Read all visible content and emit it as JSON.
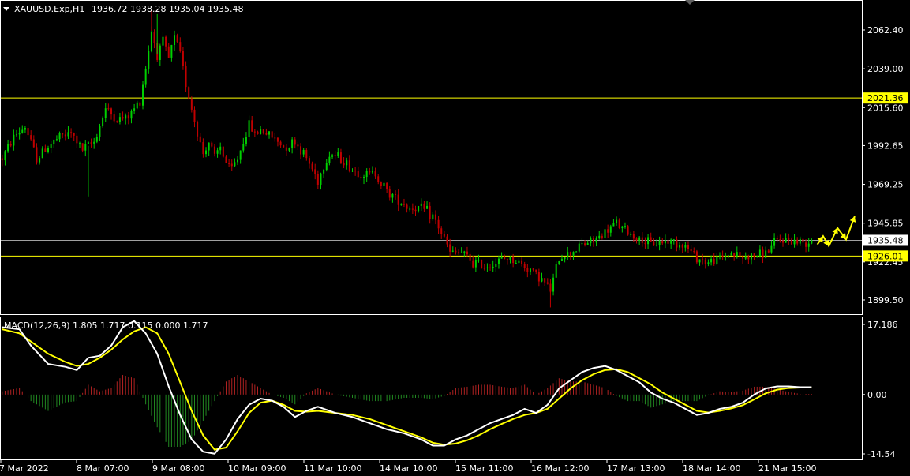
{
  "header": {
    "symbol": "XAUUSD.Exp,H1",
    "ohlc": "1936.72 1938.28 1935.04 1935.48"
  },
  "macd_header": {
    "label": "MACD(12,26,9) 1.805 1.717 0.115 0.000 1.717"
  },
  "colors": {
    "background": "#000000",
    "frame": "#ffffff",
    "bull": "#00d000",
    "bear": "#c00000",
    "level_line": "#ffff00",
    "price_line": "#a0a0a0",
    "macd_line": "#ffffff",
    "signal_line": "#ffff00",
    "hist_pos": "#b22222",
    "hist_neg": "#228b22",
    "arrow": "#ffff00"
  },
  "chart_data": [
    {
      "type": "candlestick",
      "title": "XAUUSD.Exp,H1",
      "ylim": [
        1893.0,
        2075.0
      ],
      "y_ticks": [
        "2062.40",
        "2039.00",
        "2015.60",
        "1992.65",
        "1969.25",
        "1945.85",
        "1922.45",
        "1899.50"
      ],
      "x_labels": [
        "7 Mar 2022",
        "8 Mar 07:00",
        "9 Mar 08:00",
        "10 Mar 09:00",
        "11 Mar 10:00",
        "14 Mar 10:00",
        "15 Mar 11:00",
        "16 Mar 12:00",
        "17 Mar 13:00",
        "18 Mar 14:00",
        "21 Mar 15:00"
      ],
      "horizontal_levels": [
        {
          "label": "2021.36",
          "value": 2021.36
        },
        {
          "label": "1926.01",
          "value": 1926.01
        }
      ],
      "current_price": {
        "label": "1935.48",
        "value": 1935.48
      },
      "close_path": [
        [
          0,
          1985
        ],
        [
          4,
          1998
        ],
        [
          8,
          2004
        ],
        [
          12,
          1985
        ],
        [
          16,
          1992
        ],
        [
          20,
          1998
        ],
        [
          24,
          2000
        ],
        [
          28,
          1990
        ],
        [
          32,
          1995
        ],
        [
          36,
          2015
        ],
        [
          40,
          2008
        ],
        [
          44,
          2010
        ],
        [
          48,
          2020
        ],
        [
          50,
          2040
        ],
        [
          52,
          2062
        ],
        [
          54,
          2048
        ],
        [
          56,
          2055
        ],
        [
          58,
          2045
        ],
        [
          60,
          2058
        ],
        [
          62,
          2048
        ],
        [
          64,
          2030
        ],
        [
          66,
          2015
        ],
        [
          68,
          2000
        ],
        [
          70,
          1988
        ],
        [
          72,
          1995
        ],
        [
          74,
          1985
        ],
        [
          76,
          1992
        ],
        [
          78,
          1982
        ],
        [
          80,
          1978
        ],
        [
          82,
          1985
        ],
        [
          84,
          1995
        ],
        [
          86,
          2005
        ],
        [
          88,
          2000
        ],
        [
          90,
          2002
        ],
        [
          94,
          1998
        ],
        [
          98,
          1992
        ],
        [
          102,
          1995
        ],
        [
          106,
          1985
        ],
        [
          110,
          1972
        ],
        [
          114,
          1988
        ],
        [
          118,
          1985
        ],
        [
          122,
          1978
        ],
        [
          126,
          1975
        ],
        [
          130,
          1976
        ],
        [
          134,
          1965
        ],
        [
          138,
          1960
        ],
        [
          142,
          1955
        ],
        [
          146,
          1955
        ],
        [
          150,
          1950
        ],
        [
          153,
          1940
        ],
        [
          156,
          1928
        ],
        [
          160,
          1928
        ],
        [
          164,
          1922
        ],
        [
          168,
          1920
        ],
        [
          172,
          1922
        ],
        [
          176,
          1925
        ],
        [
          180,
          1922
        ],
        [
          184,
          1918
        ],
        [
          188,
          1912
        ],
        [
          191,
          1905
        ],
        [
          194,
          1925
        ],
        [
          198,
          1928
        ],
        [
          202,
          1933
        ],
        [
          206,
          1935
        ],
        [
          210,
          1940
        ],
        [
          214,
          1946
        ],
        [
          218,
          1940
        ],
        [
          222,
          1936
        ],
        [
          226,
          1933
        ],
        [
          230,
          1935
        ],
        [
          234,
          1935
        ],
        [
          238,
          1932
        ],
        [
          242,
          1925
        ],
        [
          246,
          1922
        ],
        [
          250,
          1925
        ],
        [
          254,
          1928
        ],
        [
          258,
          1925
        ],
        [
          262,
          1926
        ],
        [
          266,
          1928
        ],
        [
          270,
          1935
        ],
        [
          274,
          1936
        ],
        [
          278,
          1934
        ],
        [
          282,
          1935.48
        ]
      ],
      "forecast_arrow": [
        [
          284,
          1933
        ],
        [
          286,
          1938
        ],
        [
          288,
          1932
        ],
        [
          291,
          1943
        ],
        [
          294,
          1936
        ],
        [
          297,
          1950
        ]
      ]
    },
    {
      "type": "macd",
      "title": "MACD(12,26,9)",
      "params": [
        12,
        26,
        9
      ],
      "values": {
        "macd": 1.805,
        "signal": 1.717,
        "osma": 0.115,
        "level": 0.0,
        "value": 1.717
      },
      "ylim": [
        -15.5,
        18.0
      ],
      "y_ticks": [
        "17.186",
        "0.00",
        "-14.54"
      ],
      "series": [
        {
          "name": "MACD",
          "points": [
            [
              0,
              16.5
            ],
            [
              6,
              16.0
            ],
            [
              10,
              12.0
            ],
            [
              16,
              7.5
            ],
            [
              22,
              6.8
            ],
            [
              26,
              6.0
            ],
            [
              30,
              9.0
            ],
            [
              34,
              9.5
            ],
            [
              38,
              12.0
            ],
            [
              42,
              16.5
            ],
            [
              46,
              18.0
            ],
            [
              50,
              15.0
            ],
            [
              54,
              10.0
            ],
            [
              58,
              2.0
            ],
            [
              62,
              -5.0
            ],
            [
              66,
              -11.0
            ],
            [
              70,
              -14.0
            ],
            [
              74,
              -14.5
            ],
            [
              78,
              -11.0
            ],
            [
              82,
              -6.0
            ],
            [
              86,
              -2.5
            ],
            [
              90,
              -1.0
            ],
            [
              94,
              -1.5
            ],
            [
              98,
              -3.0
            ],
            [
              102,
              -5.5
            ],
            [
              106,
              -4.0
            ],
            [
              110,
              -3.0
            ],
            [
              116,
              -4.5
            ],
            [
              122,
              -5.5
            ],
            [
              128,
              -7.0
            ],
            [
              134,
              -8.5
            ],
            [
              140,
              -9.5
            ],
            [
              146,
              -11.0
            ],
            [
              150,
              -12.5
            ],
            [
              154,
              -12.5
            ],
            [
              158,
              -11.0
            ],
            [
              162,
              -10.0
            ],
            [
              166,
              -8.5
            ],
            [
              170,
              -7.0
            ],
            [
              174,
              -6.0
            ],
            [
              178,
              -5.0
            ],
            [
              182,
              -3.5
            ],
            [
              186,
              -4.5
            ],
            [
              190,
              -2.5
            ],
            [
              194,
              1.5
            ],
            [
              198,
              3.5
            ],
            [
              202,
              5.5
            ],
            [
              206,
              6.5
            ],
            [
              210,
              7.0
            ],
            [
              214,
              6.0
            ],
            [
              218,
              4.5
            ],
            [
              222,
              3.0
            ],
            [
              226,
              0.5
            ],
            [
              230,
              -1.0
            ],
            [
              234,
              -2.0
            ],
            [
              238,
              -3.5
            ],
            [
              242,
              -5.0
            ],
            [
              246,
              -4.5
            ],
            [
              250,
              -3.5
            ],
            [
              254,
              -3.0
            ],
            [
              258,
              -2.0
            ],
            [
              262,
              0.0
            ],
            [
              266,
              1.5
            ],
            [
              270,
              2.0
            ],
            [
              274,
              2.0
            ],
            [
              278,
              1.8
            ],
            [
              282,
              1.805
            ]
          ]
        },
        {
          "name": "Signal",
          "points": [
            [
              0,
              16.0
            ],
            [
              6,
              15.0
            ],
            [
              10,
              13.0
            ],
            [
              16,
              10.0
            ],
            [
              22,
              8.0
            ],
            [
              26,
              7.0
            ],
            [
              30,
              7.5
            ],
            [
              34,
              9.0
            ],
            [
              38,
              11.0
            ],
            [
              42,
              13.5
            ],
            [
              46,
              15.5
            ],
            [
              50,
              16.5
            ],
            [
              54,
              15.0
            ],
            [
              58,
              10.0
            ],
            [
              62,
              3.0
            ],
            [
              66,
              -4.0
            ],
            [
              70,
              -10.0
            ],
            [
              74,
              -13.5
            ],
            [
              78,
              -13.0
            ],
            [
              82,
              -9.0
            ],
            [
              86,
              -4.5
            ],
            [
              90,
              -2.0
            ],
            [
              94,
              -1.5
            ],
            [
              98,
              -2.5
            ],
            [
              102,
              -4.0
            ],
            [
              106,
              -4.2
            ],
            [
              110,
              -4.0
            ],
            [
              116,
              -4.5
            ],
            [
              122,
              -5.0
            ],
            [
              128,
              -6.0
            ],
            [
              134,
              -7.5
            ],
            [
              140,
              -9.0
            ],
            [
              146,
              -10.5
            ],
            [
              150,
              -11.8
            ],
            [
              154,
              -12.3
            ],
            [
              158,
              -12.0
            ],
            [
              162,
              -11.2
            ],
            [
              166,
              -10.0
            ],
            [
              170,
              -8.5
            ],
            [
              174,
              -7.2
            ],
            [
              178,
              -6.0
            ],
            [
              182,
              -5.0
            ],
            [
              186,
              -4.5
            ],
            [
              190,
              -3.5
            ],
            [
              194,
              -1.0
            ],
            [
              198,
              1.5
            ],
            [
              202,
              3.5
            ],
            [
              206,
              5.0
            ],
            [
              210,
              6.0
            ],
            [
              214,
              6.2
            ],
            [
              218,
              5.5
            ],
            [
              222,
              4.0
            ],
            [
              226,
              2.5
            ],
            [
              230,
              0.5
            ],
            [
              234,
              -1.0
            ],
            [
              238,
              -2.5
            ],
            [
              242,
              -4.0
            ],
            [
              246,
              -4.4
            ],
            [
              250,
              -4.0
            ],
            [
              254,
              -3.4
            ],
            [
              258,
              -2.6
            ],
            [
              262,
              -1.2
            ],
            [
              266,
              0.3
            ],
            [
              270,
              1.2
            ],
            [
              274,
              1.6
            ],
            [
              278,
              1.7
            ],
            [
              282,
              1.717
            ]
          ]
        }
      ]
    }
  ]
}
